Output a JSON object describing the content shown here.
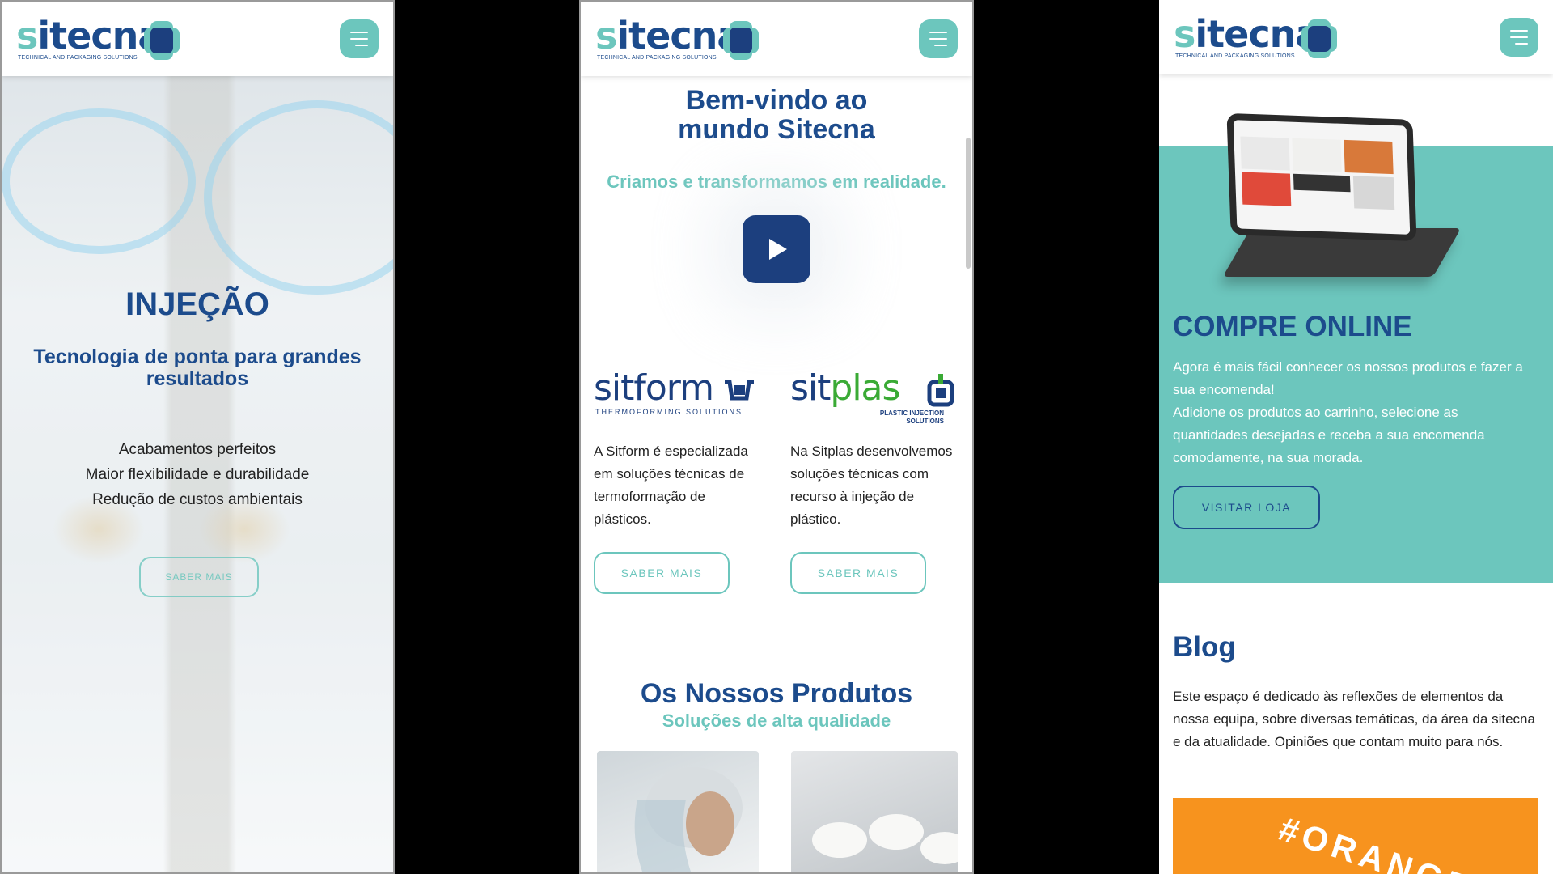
{
  "brand": {
    "logo_text": "sitecna",
    "tagline": "TECHNICAL AND PACKAGING SOLUTIONS",
    "colors": {
      "navy": "#1c4b8c",
      "teal": "#6cc6bd",
      "dark_navy": "#1c3f7e",
      "orange": "#f7931e"
    }
  },
  "menu_icon": "hamburger-menu-icon",
  "panel1": {
    "title": "INJEÇÃO",
    "subtitle": "Tecnologia de ponta para grandes resultados",
    "features": [
      "Acabamentos perfeitos",
      "Maior flexibilidade e durabilidade",
      "Redução de custos ambientais"
    ],
    "button": "SABER MAIS"
  },
  "panel2": {
    "welcome": "Bem-vindo ao mundo Sitecna",
    "tagline": "Criamos e transformamos em realidade.",
    "play_icon": "play-icon",
    "sitform": {
      "logo": "sitform",
      "logo_tag": "THERMOFORMING SOLUTIONS",
      "text": "A Sitform é especializada em soluções técnicas de termoformação de plásticos.",
      "button": "SABER MAIS"
    },
    "sitplas": {
      "logo": "sitplas",
      "logo_tag": "PLASTIC INJECTION SOLUTIONS",
      "text": "Na Sitplas desenvolvemos soluções técnicas com recurso à injeção de plástico.",
      "button": "SABER MAIS"
    },
    "products_title": "Os Nossos Produtos",
    "products_subtitle": "Soluções de alta qualidade"
  },
  "panel3": {
    "shop_title": "COMPRE ONLINE",
    "shop_text_1": "Agora é mais fácil conhecer os nossos produtos e fazer a sua encomenda!",
    "shop_text_2": "Adicione os produtos ao carrinho, selecione as quantidades desejadas e receba a sua encomenda comodamente, na sua morada.",
    "shop_button": "VISITAR LOJA",
    "blog_title": "Blog",
    "blog_text": "Este espaço é dedicado às reflexões de elementos da nossa equipa, sobre diversas temáticas, da área da sitecna e da atualidade. Opiniões que contam muito para nós.",
    "banner_text": "#ORANGE"
  }
}
